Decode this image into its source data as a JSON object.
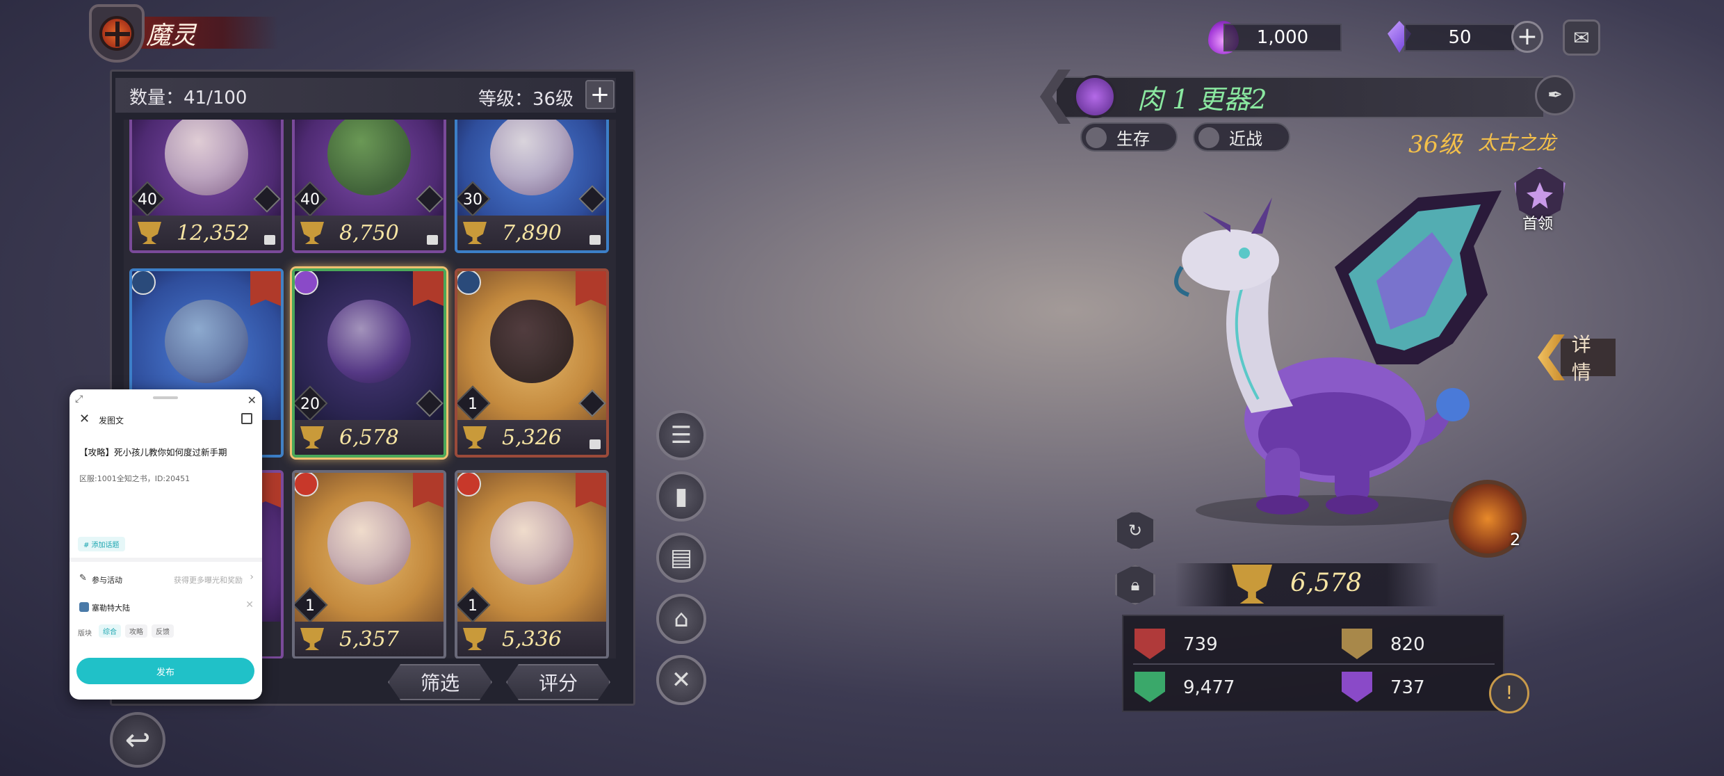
{
  "header": {
    "title": "魔灵"
  },
  "roster": {
    "count_label": "数量：41/100",
    "level_label": "等级：36级",
    "plus": "+",
    "cards": [
      {
        "level": "40",
        "power": "12,352"
      },
      {
        "level": "40",
        "power": "8,750"
      },
      {
        "level": "30",
        "power": "7,890"
      },
      {
        "level": "",
        "power": ""
      },
      {
        "level": "20",
        "power": "6,578"
      },
      {
        "level": "1",
        "power": "5,326"
      },
      {
        "level": "",
        "power": ""
      },
      {
        "level": "1",
        "power": "5,357"
      },
      {
        "level": "1",
        "power": "5,336"
      }
    ],
    "filter_label": "筛选",
    "score_label": "评分"
  },
  "currency": {
    "soul": "1,000",
    "gem": "50"
  },
  "hero": {
    "name": "肉 1 更器2",
    "tag_survival": "生存",
    "tag_melee": "近战",
    "level": "36级",
    "class": "太古之龙",
    "leader": "首领",
    "details": "详情",
    "skill_count": "2",
    "power": "6,578",
    "stats": {
      "attack": "739",
      "defense": "820",
      "hp": "9,477",
      "magic": "737"
    }
  },
  "chat_panel": {
    "header_title": "发图文",
    "post_title": "【攻略】死小孩儿教你如何度过新手期",
    "post_body": "区服:1001全知之书，ID:20451",
    "add_topic": "# 添加话题",
    "event_label": "参与活动",
    "event_hint": "获得更多曝光和奖励",
    "game_label": "塞勒特大陆",
    "section_label": "版块",
    "chips": [
      "综合",
      "攻略",
      "反馈"
    ],
    "publish": "发布"
  },
  "colors": {
    "hero_name": "#8ae8a0",
    "power_gold": "#f8e6a4",
    "accent_teal": "#20c1c8"
  }
}
